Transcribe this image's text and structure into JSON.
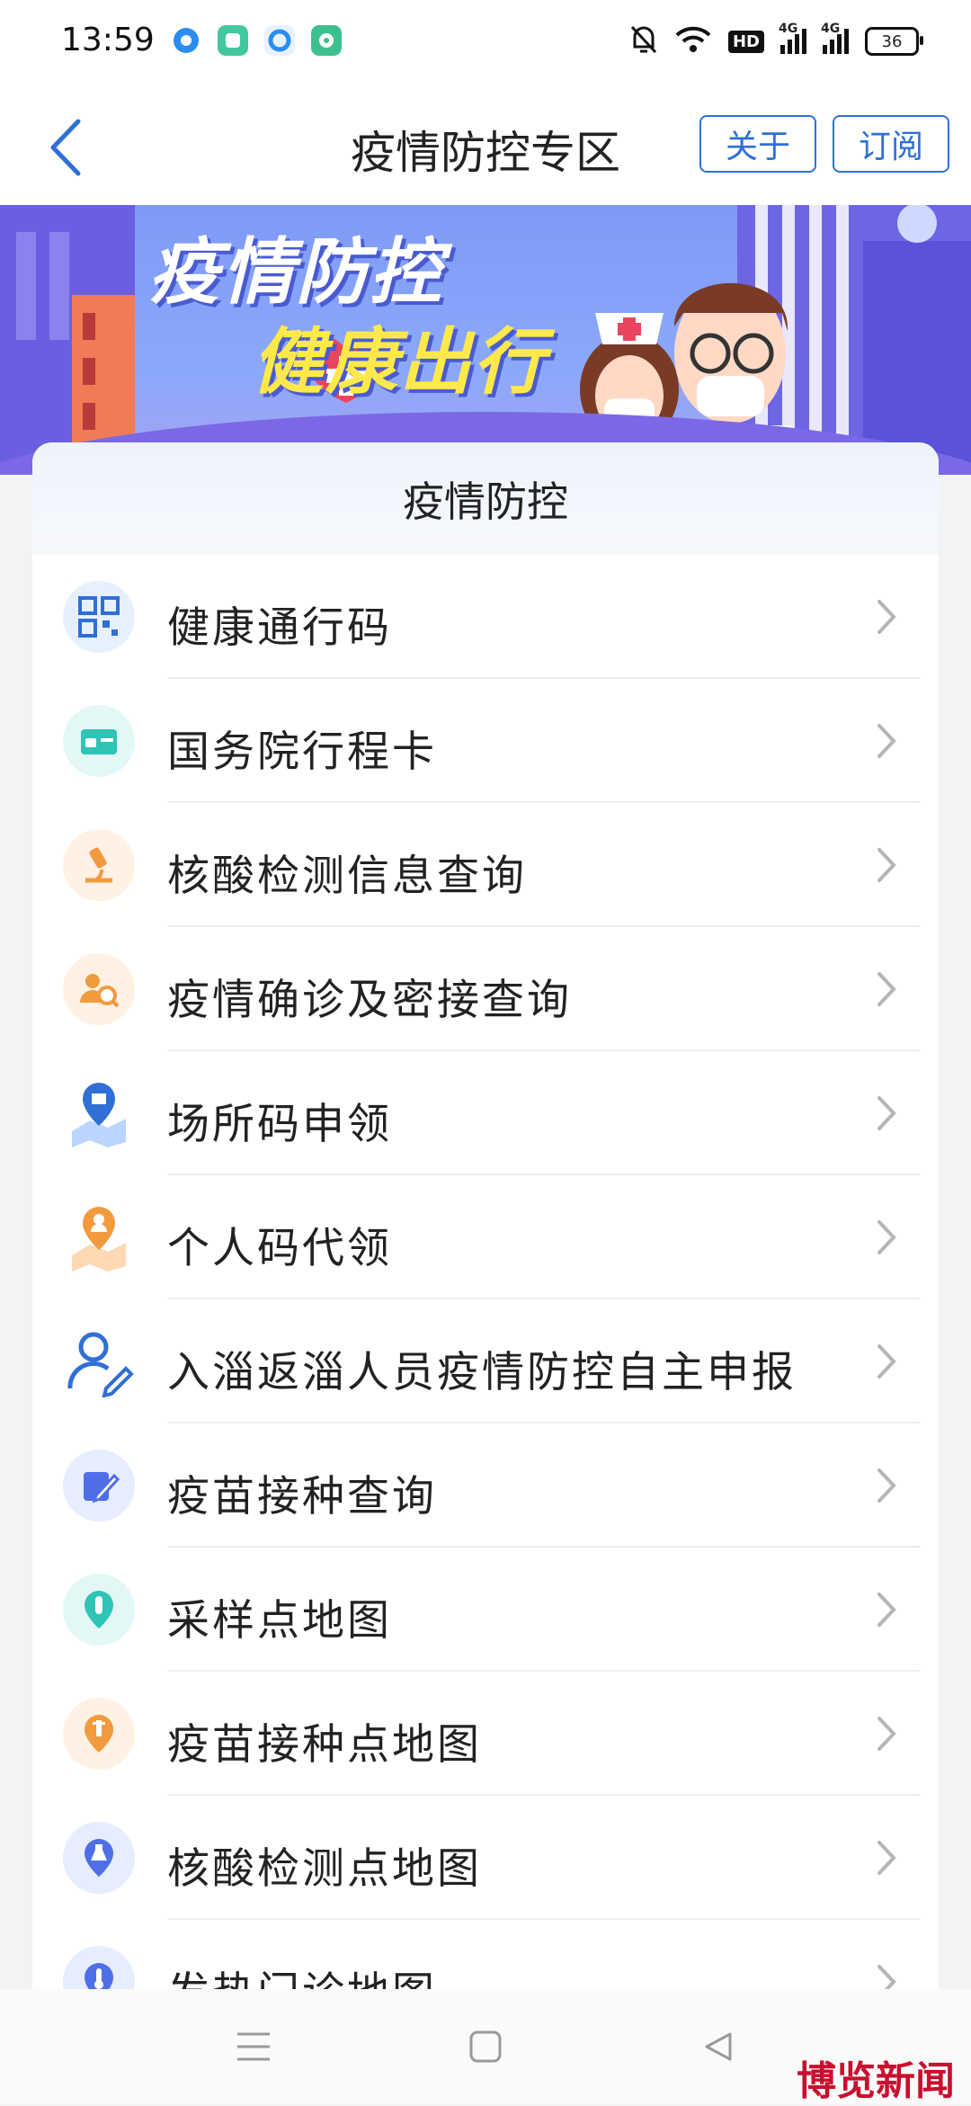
{
  "status_bar": {
    "time": "13:59",
    "network_labels": [
      "4G",
      "4G"
    ],
    "hd_label": "HD",
    "battery_level": "36"
  },
  "header": {
    "title": "疫情防控专区",
    "about_label": "关于",
    "subscribe_label": "订阅"
  },
  "banner": {
    "title_line1": "疫情防控",
    "title_line2": "健康出行"
  },
  "card": {
    "heading": "疫情防控",
    "items": [
      {
        "label": "健康通行码",
        "icon": "qr-code-icon"
      },
      {
        "label": "国务院行程卡",
        "icon": "travel-card-icon"
      },
      {
        "label": "核酸检测信息查询",
        "icon": "microscope-icon"
      },
      {
        "label": "疫情确诊及密接查询",
        "icon": "people-search-icon"
      },
      {
        "label": "场所码申领",
        "icon": "venue-location-icon"
      },
      {
        "label": "个人码代领",
        "icon": "personal-location-icon"
      },
      {
        "label": "入淄返淄人员疫情防控自主申报",
        "icon": "user-edit-icon"
      },
      {
        "label": "疫苗接种查询",
        "icon": "edit-note-icon"
      },
      {
        "label": "采样点地图",
        "icon": "test-tube-pin-icon"
      },
      {
        "label": "疫苗接种点地图",
        "icon": "syringe-pin-icon"
      },
      {
        "label": "核酸检测点地图",
        "icon": "flask-pin-icon"
      },
      {
        "label": "发热门诊地图",
        "icon": "thermometer-pin-icon"
      }
    ]
  },
  "watermark": "博览新闻",
  "colors": {
    "accent": "#2f6fd6",
    "banner": "#8aa8fb"
  }
}
